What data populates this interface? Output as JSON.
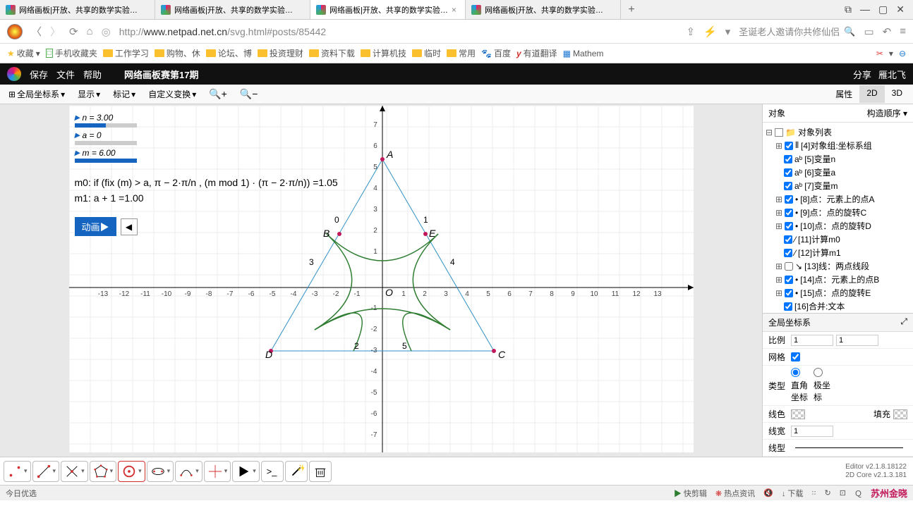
{
  "tabs": {
    "t1": "网络画板|开放、共享的数学实验…",
    "t2": "网络画板|开放、共享的数学实验…",
    "t3": "网络画板|开放、共享的数学实验…",
    "t4": "网络画板|开放、共享的数学实验…",
    "close": "×",
    "new": "+"
  },
  "winControls": {
    "panel": "⧉",
    "min": "—",
    "max": "▢",
    "close": "✕"
  },
  "url": {
    "proto": "http://",
    "host": "www.netpad.net.cn",
    "path": "/svg.html#posts/85442",
    "searchPlaceholder": "圣诞老人邀请你共修仙侣"
  },
  "bookmarks": {
    "fav": "收藏",
    "b1": "手机收藏夹",
    "b2": "工作学习",
    "b3": "购物、休",
    "b4": "论坛、博",
    "b5": "投资理财",
    "b6": "资料下载",
    "b7": "计算机技",
    "b8": "临时",
    "b9": "常用",
    "b10": "百度",
    "b11": "有道翻译",
    "b12": "Mathem"
  },
  "appHeader": {
    "save": "保存",
    "file": "文件",
    "help": "帮助",
    "title": "网络画板赛第17期",
    "share": "分享",
    "user": "雁北飞"
  },
  "toolbar": {
    "coord": "全局坐标系",
    "show": "显示",
    "mark": "标记",
    "custom": "自定义变换",
    "prop": "属性",
    "d2": "2D",
    "d3": "3D"
  },
  "vars": {
    "n": "n = 3.00",
    "a": "a = 0",
    "m": "m = 6.00"
  },
  "formula": {
    "m0": "m0: if (fix (m) > a, π − 2·π/n , (m mod 1) · (π − 2·π/n)) =1.05",
    "m1": "m1: a + 1 =1.00"
  },
  "anim": {
    "btn": "动画▶",
    "prev": "◀"
  },
  "plot": {
    "points": {
      "A": "A",
      "B": "B",
      "C": "C",
      "D": "D",
      "E": "E",
      "O": "O"
    },
    "arcLabels": [
      "0",
      "1",
      "2",
      "3",
      "4",
      "5"
    ]
  },
  "sidePanel": {
    "hdr": "对象",
    "order": "构造顺序",
    "root": "对象列表",
    "items": {
      "i4": "[4]对象组:坐标系组",
      "i5": "[5]变量n",
      "i6": "[6]变量a",
      "i7": "[7]变量m",
      "i8": "[8]点：元素上的点A",
      "i9": "[9]点：点的旋转C",
      "i10": "[10]点：点的旋转D",
      "i11": "[11]计算m0",
      "i12": "[12]计算m1",
      "i13": "[13]线：两点线段",
      "i14": "[14]点：元素上的点B",
      "i15": "[15]点：点的旋转E",
      "i16": "[16]合并:文本"
    },
    "propsHdr": "全局坐标系",
    "props": {
      "scale": "比例",
      "scaleX": "1",
      "scaleY": "1",
      "grid": "网格",
      "type": "类型",
      "ortho": "直角坐标",
      "polar": "极坐标",
      "linecolor": "线色",
      "fill": "填充",
      "linewidth": "线宽",
      "lw": "1",
      "linestyle": "线型"
    }
  },
  "bottom": {
    "editor": "Editor v2.1.8.18122",
    "core": "2D Core v2.1.3.181"
  },
  "status": {
    "today": "今日优选",
    "cut": "快剪辑",
    "hot": "热点资讯",
    "dl": "↓ 下载",
    "brand": "苏州金晓"
  }
}
